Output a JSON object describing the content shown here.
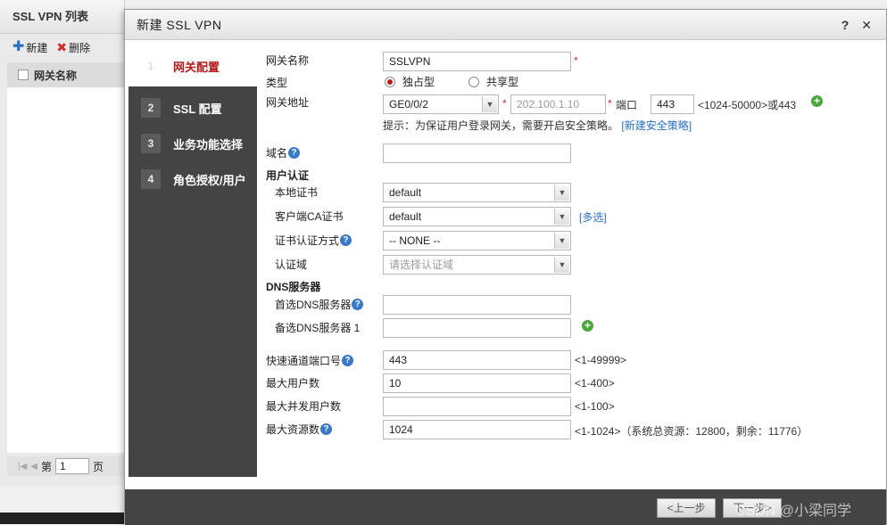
{
  "list_panel": {
    "title": "SSL VPN 列表",
    "new_label": "新建",
    "delete_label": "删除",
    "column_header": "网关名称",
    "pager_label": "第",
    "page_value": "1",
    "page_suffix": "页"
  },
  "dialog": {
    "title": "新建 SSL VPN",
    "help_label": "?",
    "close_label": "✕"
  },
  "wizard": {
    "steps": [
      {
        "num": "1",
        "label": "网关配置"
      },
      {
        "num": "2",
        "label": "SSL 配置"
      },
      {
        "num": "3",
        "label": "业务功能选择"
      },
      {
        "num": "4",
        "label": "角色授权/用户"
      }
    ]
  },
  "form": {
    "gateway_name_label": "网关名称",
    "gateway_name_value": "SSLVPN",
    "type_label": "类型",
    "type_exclusive": "独占型",
    "type_shared": "共享型",
    "gateway_addr_label": "网关地址",
    "interface_value": "GE0/0/2",
    "ip_placeholder": "202.100.1.10",
    "port_label": "端口",
    "port_value": "443",
    "port_range": "<1024-50000>或443",
    "tip_text": "提示：为保证用户登录网关，需要开启安全策略。",
    "tip_link": "[新建安全策略]",
    "domain_label": "域名",
    "user_auth_label": "用户认证",
    "local_cert_label": "本地证书",
    "local_cert_value": "default",
    "client_ca_label": "客户端CA证书",
    "client_ca_value": "default",
    "multi_select": "[多选]",
    "cert_auth_label": "证书认证方式",
    "cert_auth_value": "-- NONE --",
    "auth_domain_label": "认证域",
    "auth_domain_placeholder": "请选择认证域",
    "dns_label": "DNS服务器",
    "pref_dns_label": "首选DNS服务器",
    "alt_dns_label": "备选DNS服务器 1",
    "fast_port_label": "快速通道端口号",
    "fast_port_value": "443",
    "fast_port_range": "<1-49999>",
    "max_users_label": "最大用户数",
    "max_users_value": "10",
    "max_users_range": "<1-400>",
    "max_concurrent_label": "最大并发用户数",
    "max_concurrent_range": "<1-100>",
    "max_resources_label": "最大资源数",
    "max_resources_value": "1024",
    "max_resources_range": "<1-1024>（系统总资源：12800，剩余：11776）"
  },
  "footer": {
    "prev_label": "<上一步",
    "next_label": "下一步>",
    "watermark": "CSDN @小梁同学"
  }
}
